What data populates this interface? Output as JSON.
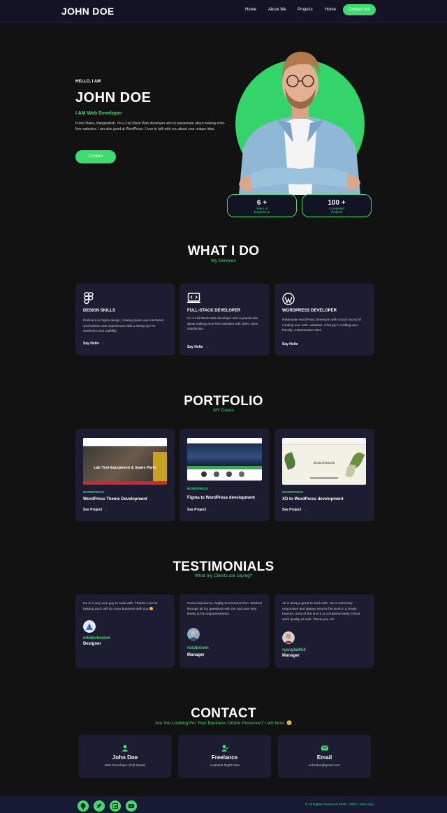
{
  "nav": {
    "logo": "JOHN DOE",
    "links": [
      "Home",
      "About Me",
      "Projects",
      "Home"
    ],
    "cta": "Contact me"
  },
  "hero": {
    "hello": "HELLO, I AM",
    "name": "JOHN DOE",
    "role": "I AM Web Developer",
    "description": "From Dhaka, Bangladesh. I'm a Full Stack Web developer who is passionate about making error-free websites. I am also good at WordPress. I love to talk with you about your unique idea.",
    "button": "Contact",
    "stats": [
      {
        "value": "6 +",
        "label1": "Years of",
        "label2": "Experience"
      },
      {
        "value": "100 +",
        "label1": "Completed",
        "label2": "Projects"
      }
    ]
  },
  "services": {
    "title": "WHAT I DO",
    "subtitle": "My Services",
    "items": [
      {
        "icon": "figma-icon",
        "title": "DESIGN SKILLS",
        "desc": "Proficient in Figma design, creating sleek user interfaces and intuitive user experiences with a strong eye for aesthetics and usability.",
        "link": "Say Hello"
      },
      {
        "icon": "code-laptop-icon",
        "title": "FULL-STACK DEVELOPER",
        "desc": "I'm a Full Stack Web developer who is passionate about making error-free websites with 100% client satisfaction.",
        "link": "Say Hello"
      },
      {
        "icon": "wordpress-icon",
        "title": "WORDPRESS DEVELOPER",
        "desc": "Passionate WordPress Developer with a track record of creating over 100+ websites. I find joy in crafting user-friendly, customization sites.",
        "link": "Say Hello"
      }
    ]
  },
  "portfolio": {
    "title": "PORTFOLIO",
    "subtitle": "MY Cases",
    "items": [
      {
        "banner": "Lab Test Equipment & Spare Parts",
        "tag": "WORDPRESS",
        "title": "WordPress Theme Development",
        "link": "See Project"
      },
      {
        "tag": "WORDPRESS",
        "title": "Figma to WordPress development",
        "link": "See Project"
      },
      {
        "banner": "ECOLÓGICOS",
        "tag": "WORDPRESS",
        "title": "XD to WordPress development",
        "link": "See Project"
      }
    ]
  },
  "testimonials": {
    "title": "TESTIMONIALS",
    "subtitle": "What my Clients are saying?",
    "items": [
      {
        "text": "He is a very nice guy to work with. Thanks a lot for helping and I will do more business with you 😊",
        "name": "mbdevboston",
        "role": "Designer"
      },
      {
        "text": "Great experience, highly recommend him. Worked through all my questions with me and was very timely in his responsiveness.",
        "name": "rossbrown",
        "role": "Manager"
      },
      {
        "text": "Ali is always great to work with. He is extremely responsive and always returns his work in a timely manner, most of the time it is completed early! Great work quality as well. Thank you Ali!",
        "name": "ryangladhill",
        "role": "Manager"
      }
    ]
  },
  "contact": {
    "title": "CONTACT",
    "subtitle": "Are You Looking For Your Business Online Presence? I am here. 😊",
    "items": [
      {
        "icon": "user-icon",
        "title": "John Doe",
        "sub": "Web Developer (Full-Stack)"
      },
      {
        "icon": "user-check-icon",
        "title": "Freelance",
        "sub": "Available Right Now"
      },
      {
        "icon": "envelope-icon",
        "title": "Email",
        "sub": "Johndoe@gmail.com"
      }
    ]
  },
  "footer": {
    "social": [
      "github-icon",
      "twitter-icon",
      "linkedin-icon",
      "youtube-icon"
    ],
    "copyright": "© All Rights Reserved 2018 - 2024 | John Doe"
  },
  "colors": {
    "accent": "#3ddc6f",
    "card": "#1c1c33",
    "background": "#121212"
  }
}
